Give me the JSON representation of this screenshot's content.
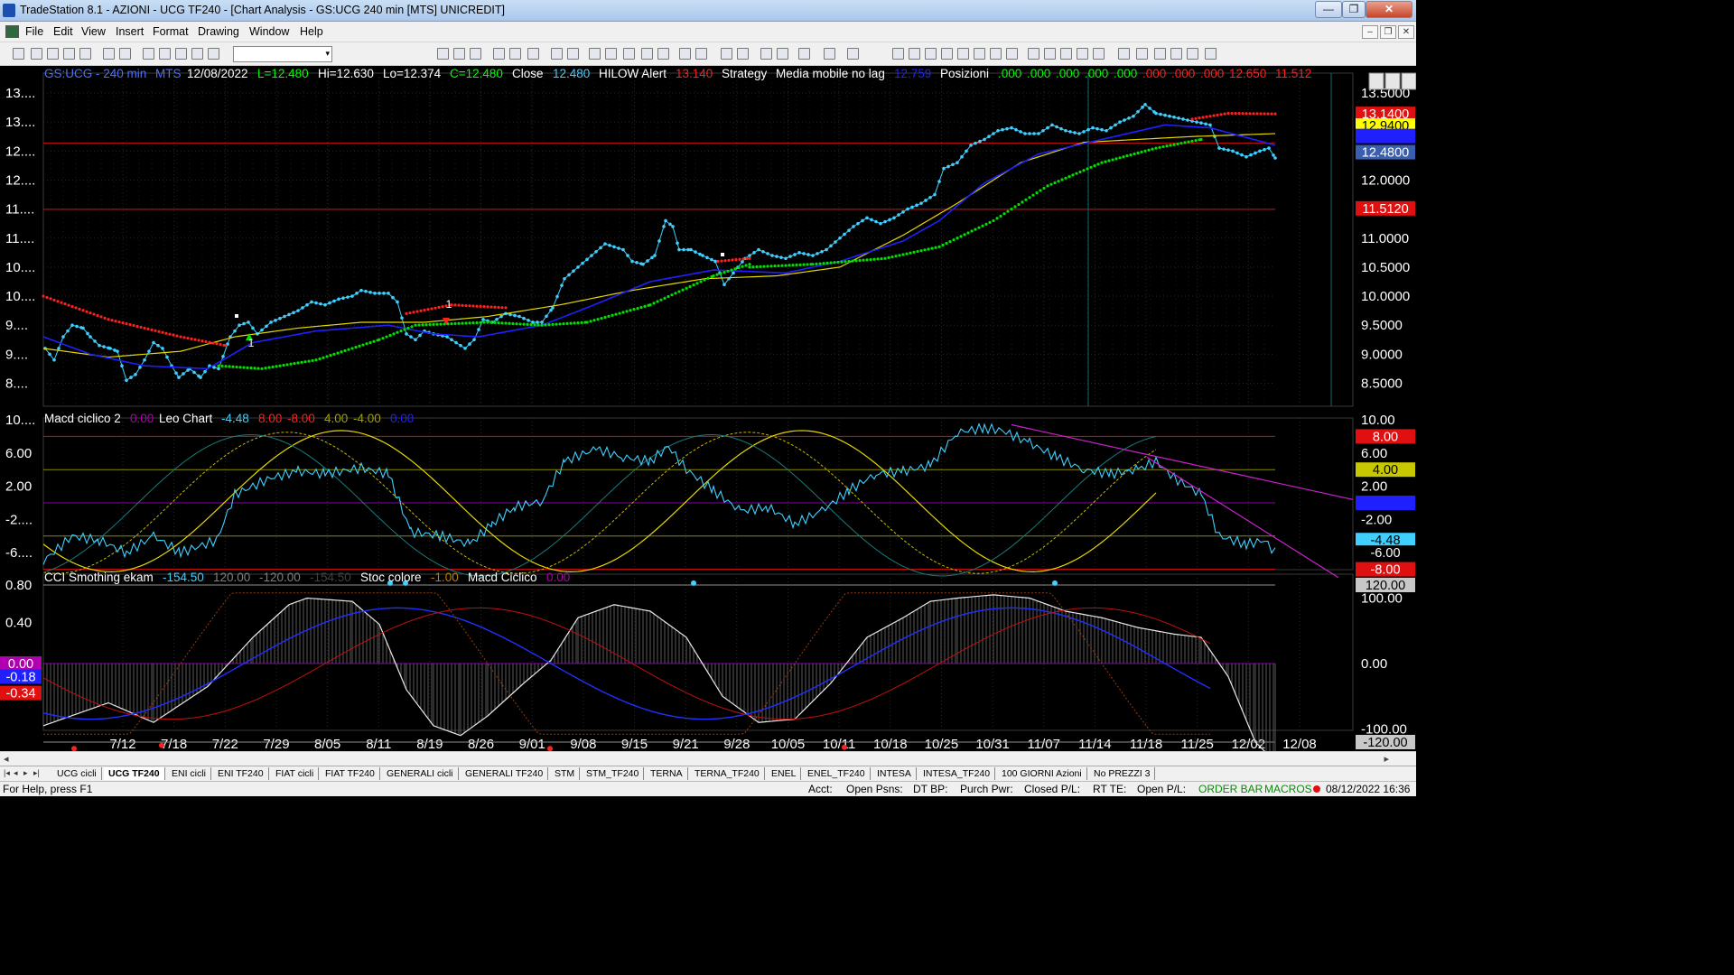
{
  "window": {
    "title": "TradeStation 8.1 - AZIONI - UCG TF240 - [Chart Analysis - GS:UCG  240 min  [MTS] UNICREDIT]",
    "minimize": "—",
    "maximize": "❐",
    "close": "✕"
  },
  "menu": [
    "File",
    "Edit",
    "View",
    "Insert",
    "Format",
    "Drawing",
    "Window",
    "Help"
  ],
  "mdi_buttons": [
    "–",
    "❐",
    "✕"
  ],
  "toolbar": {
    "symbol_value": "",
    "combo_arrow": "▾"
  },
  "header1": [
    {
      "text": "GS:UCG - 240 min",
      "color": "#4f6fff"
    },
    {
      "text": "MTS",
      "color": "#4f6fff"
    },
    {
      "text": "12/08/2022",
      "color": "#ffffff"
    },
    {
      "text": "L=12.480",
      "color": "#00ff00"
    },
    {
      "text": "Hi=12.630",
      "color": "#ffffff"
    },
    {
      "text": "Lo=12.374",
      "color": "#ffffff"
    },
    {
      "text": "C=12.480",
      "color": "#00ff00"
    },
    {
      "text": "Close",
      "color": "#ffffff"
    },
    {
      "text": "12.480",
      "color": "#3fd0ff"
    },
    {
      "text": "HILOW Alert",
      "color": "#ffffff"
    },
    {
      "text": "13.140",
      "color": "#ff2020"
    },
    {
      "text": "Strategy",
      "color": "#ffffff"
    },
    {
      "text": "Media mobile no lag",
      "color": "#ffffff"
    },
    {
      "text": "12.759",
      "color": "#2020ff"
    },
    {
      "text": "Posizioni",
      "color": "#ffffff"
    },
    {
      "text": ".000",
      "color": "#00ff00"
    },
    {
      "text": ".000",
      "color": "#00ff00"
    },
    {
      "text": ".000",
      "color": "#00ff00"
    },
    {
      "text": ".000",
      "color": "#00ff00"
    },
    {
      "text": ".000",
      "color": "#00ff00"
    },
    {
      "text": ".000",
      "color": "#ff2020"
    },
    {
      "text": ".000",
      "color": "#ff2020"
    },
    {
      "text": ".000",
      "color": "#ff2020"
    },
    {
      "text": "12.650",
      "color": "#ff2020"
    },
    {
      "text": "11.512",
      "color": "#ff2020"
    }
  ],
  "header2": [
    {
      "text": "Macd ciclico 2",
      "color": "#ffffff"
    },
    {
      "text": "0.00",
      "color": "#b000b0"
    },
    {
      "text": "Leo Chart",
      "color": "#ffffff"
    },
    {
      "text": "-4.48",
      "color": "#3fd0ff"
    },
    {
      "text": "8.00",
      "color": "#ff2020"
    },
    {
      "text": "-8.00",
      "color": "#ff2020"
    },
    {
      "text": "4.00",
      "color": "#a0a000"
    },
    {
      "text": "-4.00",
      "color": "#a0a000"
    },
    {
      "text": "0.00",
      "color": "#2020ff"
    }
  ],
  "header3": [
    {
      "text": "CCI Smothing ekam",
      "color": "#ffffff"
    },
    {
      "text": "-154.50",
      "color": "#3fd0ff"
    },
    {
      "text": "120.00",
      "color": "#808080"
    },
    {
      "text": "-120.00",
      "color": "#808080"
    },
    {
      "text": "-154.50",
      "color": "#404040"
    },
    {
      "text": "Stoc colore",
      "color": "#ffffff"
    },
    {
      "text": "-1.00",
      "color": "#c08000"
    },
    {
      "text": "Macd Ciclico",
      "color": "#ffffff"
    },
    {
      "text": "0.00",
      "color": "#b000b0"
    }
  ],
  "price_axis_left": [
    "13....",
    "13....",
    "12....",
    "12....",
    "11....",
    "11....",
    "10....",
    "10....",
    "9....",
    "9....",
    "8...."
  ],
  "price_axis_right": [
    "13.5000",
    "13.0000",
    "12.5000",
    "12.0000",
    "11.5000",
    "11.0000",
    "10.5000",
    "10.0000",
    "9.5000",
    "9.0000",
    "8.5000"
  ],
  "price_markers": [
    {
      "text": "13.1400",
      "bg": "#e01010",
      "fg": "#ffffff"
    },
    {
      "text": "12.9400",
      "bg": "#ffff00",
      "fg": "#000000"
    },
    {
      "text": "12.7590",
      "bg": "#2020ff",
      "fg": "#2020ff"
    },
    {
      "text": "12.4800",
      "bg": "#3a5fb0",
      "fg": "#ffffff"
    },
    {
      "text": "11.5120",
      "bg": "#e01010",
      "fg": "#ffffff"
    }
  ],
  "macd_axis_left": [
    "10....",
    "6.00",
    "2.00",
    "-2....",
    "-6...."
  ],
  "macd_axis_right": [
    "10.00",
    "6.00",
    "2.00",
    "-2.00",
    "-6.00"
  ],
  "macd_markers": [
    {
      "text": "8.00",
      "bg": "#e01010",
      "fg": "#ffffff"
    },
    {
      "text": "4.00",
      "bg": "#c8c800",
      "fg": "#000000"
    },
    {
      "text": "0.00",
      "bg": "#2020ff",
      "fg": "#2020ff"
    },
    {
      "text": "-4.48",
      "bg": "#3fd0ff",
      "fg": "#000000"
    },
    {
      "text": "-6.00",
      "bg": "#000000",
      "fg": "#ffffff"
    },
    {
      "text": "-8.00",
      "bg": "#e01010",
      "fg": "#ffffff"
    }
  ],
  "cci_axis_left": [
    "0.80",
    "0.40"
  ],
  "cci_axis_right": [
    "120.00",
    "100.00",
    "0.00",
    "-100.00"
  ],
  "cci_left_markers": [
    {
      "text": "0.00",
      "bg": "#b000b0",
      "fg": "#ffffff"
    },
    {
      "text": "-0.18",
      "bg": "#2020ff",
      "fg": "#ffffff"
    },
    {
      "text": "-0.34",
      "bg": "#e01010",
      "fg": "#ffffff"
    }
  ],
  "cci_markers": [
    {
      "text": "120.00",
      "bg": "#c8c8c8",
      "fg": "#000000"
    },
    {
      "text": "-120.00",
      "bg": "#c8c8c8",
      "fg": "#000000"
    },
    {
      "text": "-154.50",
      "bg": "#3fd0ff",
      "fg": "#000000"
    }
  ],
  "date_axis": [
    "7/12",
    "7/18",
    "7/22",
    "7/29",
    "8/05",
    "8/11",
    "8/19",
    "8/26",
    "9/01",
    "9/08",
    "9/15",
    "9/21",
    "9/28",
    "10/05",
    "10/11",
    "10/18",
    "10/25",
    "10/31",
    "11/07",
    "11/14",
    "11/18",
    "11/25",
    "12/02",
    "12/08"
  ],
  "trade_labels": [
    "1",
    "1",
    "1"
  ],
  "tabs": [
    "UCG cicli",
    "UCG TF240",
    "ENI cicli",
    "ENI TF240",
    "FIAT cicli",
    "FIAT TF240",
    "GENERALI cicli",
    "GENERALI TF240",
    "STM",
    "STM_TF240",
    "TERNA",
    "TERNA_TF240",
    "ENEL",
    "ENEL_TF240",
    "INTESA",
    "INTESA_TF240",
    "100 GIORNI Azioni",
    "No PREZZI 3"
  ],
  "tab_nav": [
    "|◂",
    "◂",
    "▸",
    "▸|"
  ],
  "status": {
    "help": "For Help, press F1",
    "acct": "Acct:",
    "open_psns": "Open Psns:",
    "dt_bp": "DT BP:",
    "purch_pwr": "Purch Pwr:",
    "closed_pl": "Closed P/L:",
    "rt_te": "RT TE:",
    "open_pl": "Open P/L:",
    "order_bar": "ORDER BAR",
    "macros": "MACROS",
    "datetime": "08/12/2022 16:36"
  },
  "colors": {
    "price": "#3fd0ff",
    "nolag": "#2020ff",
    "ma": "#e6d800",
    "hilow_up": "#00e000",
    "hilow_dn": "#ff2020",
    "grid": "#2a2a2a",
    "level": "#d01010",
    "trend": "#d020d0"
  }
}
